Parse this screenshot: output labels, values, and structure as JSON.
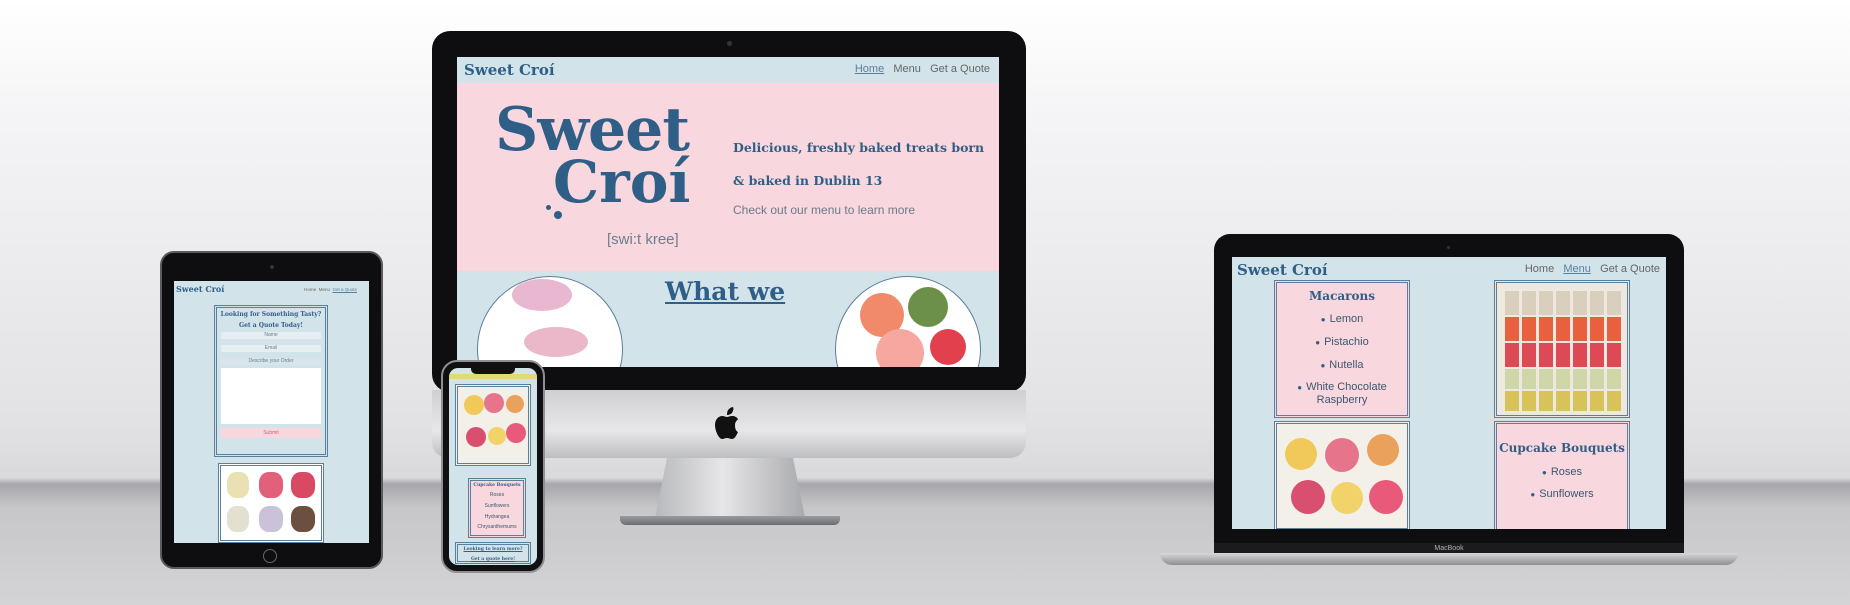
{
  "brand": "Sweet Croí",
  "nav": {
    "home": "Home",
    "menu": "Menu",
    "quote": "Get a Quote"
  },
  "hero": {
    "logo_line1": "Sweet",
    "logo_line2": "Croí",
    "pronunciation": "[swi:t kree]",
    "tagline": "Delicious, freshly baked treats born & baked in Dublin 13",
    "cta": "Check out our menu to learn more"
  },
  "what_we": "What we",
  "ipad": {
    "heading": "Looking for Something Tasty?",
    "subheading": "Get a Quote Today!",
    "name_placeholder": "Name",
    "email_placeholder": "Email",
    "order_placeholder": "Describe your Order",
    "submit": "Submit"
  },
  "phone": {
    "card_title": "Cupcake Bouquets",
    "items": [
      "Roses",
      "Sunflowers",
      "Hydrangea",
      "Chrysanthemums"
    ],
    "learn_more": "Looking to learn more?",
    "get_quote": "Get a quote here!"
  },
  "macbook": {
    "macarons_title": "Macarons",
    "macarons": [
      "Lemon",
      "Pistachio",
      "Nutella",
      "White Chocolate Raspberry"
    ],
    "cupcake_title": "Cupcake Bouquets",
    "cupcakes": [
      "Roses",
      "Sunflowers"
    ],
    "label": "MacBook"
  },
  "colors": {
    "brand_blue": "#2f5f86",
    "pink": "#f8d7de",
    "light_blue": "#d3e3ea"
  }
}
